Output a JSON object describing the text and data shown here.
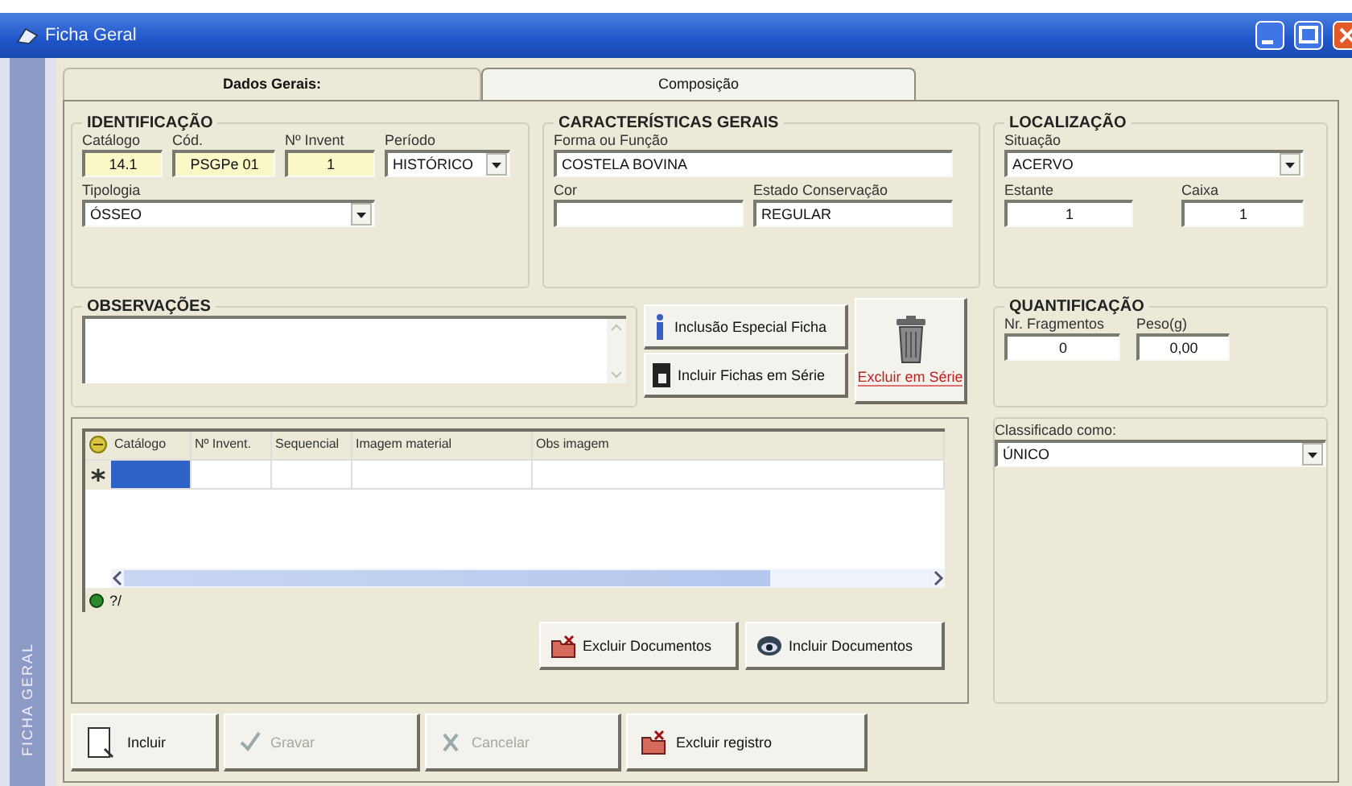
{
  "window": {
    "title": "Ficha Geral"
  },
  "side_label": "FICHA GERAL",
  "tabs": [
    {
      "label": "Dados Gerais:",
      "selected": true
    },
    {
      "label": "Composição",
      "selected": false
    }
  ],
  "identification": {
    "title": "IDENTIFICAÇÃO",
    "fields": [
      {
        "label": "Catálogo",
        "value": "14.1",
        "kind": "number",
        "highlighted": true
      },
      {
        "label": "Cód.",
        "value": "PSGPe 01",
        "kind": "number",
        "highlighted": true
      },
      {
        "label": "Nº Invent",
        "value": "1",
        "kind": "number",
        "highlighted": true
      },
      {
        "label": "Período",
        "value": "HISTÓRICO",
        "kind": "select",
        "highlighted": false
      },
      {
        "label": "Tipologia",
        "value": "ÓSSEO",
        "kind": "select",
        "highlighted": false
      }
    ]
  },
  "characteristics": {
    "title": "CARACTERÍSTICAS GERAIS",
    "fields": [
      {
        "label": "Forma ou Função",
        "value": "COSTELA BOVINA",
        "kind": "text"
      },
      {
        "label": "Cor",
        "kind": "text"
      },
      {
        "label": "Estado Conservação",
        "value": "REGULAR",
        "kind": "text"
      }
    ]
  },
  "location": {
    "title": "LOCALIZAÇÃO",
    "fields": [
      {
        "label": "Situação",
        "value": "ACERVO",
        "kind": "select"
      },
      {
        "label": "Estante",
        "value": "1",
        "kind": "number"
      },
      {
        "label": "Caixa",
        "value": "1",
        "kind": "number"
      }
    ]
  },
  "observations": {
    "title": "OBSERVAÇÕES",
    "fields": [
      {
        "kind": "memo"
      }
    ]
  },
  "record_buttons": [
    {
      "label": "Inclusão Especial Ficha",
      "kind": "info"
    },
    {
      "label": "Incluir Fichas em Série",
      "kind": "page"
    }
  ],
  "delete_series_button": {
    "label": "Excluir em Série"
  },
  "quantification": {
    "title": "QUANTIFICAÇÃO",
    "fields": [
      {
        "label": "Nr. Fragmentos",
        "value": "0",
        "kind": "number"
      },
      {
        "label": "Peso(g)",
        "value": "0,00",
        "kind": "number"
      }
    ]
  },
  "classification": {
    "fields": [
      {
        "label": "Classificado como:",
        "value": "ÚNICO",
        "kind": "select"
      }
    ]
  },
  "documents": {
    "columns": [
      "Catálogo",
      "Nº Invent.",
      "Sequencial",
      "Imagem material",
      "Obs imagem"
    ],
    "rows": [
      {
        "kind": "new",
        "selected": true
      }
    ],
    "record_position": "?/",
    "buttons": [
      {
        "label": "Excluir Documentos",
        "kind": "delete"
      },
      {
        "label": "Incluir Documentos",
        "kind": "view"
      }
    ]
  },
  "toolbar": [
    {
      "label": "Incluir",
      "kind": "new",
      "disabled": false
    },
    {
      "label": "Gravar",
      "kind": "save",
      "disabled": true
    },
    {
      "label": "Cancelar",
      "kind": "cancel",
      "disabled": true
    },
    {
      "label": "Excluir registro",
      "kind": "delete",
      "disabled": false
    }
  ]
}
